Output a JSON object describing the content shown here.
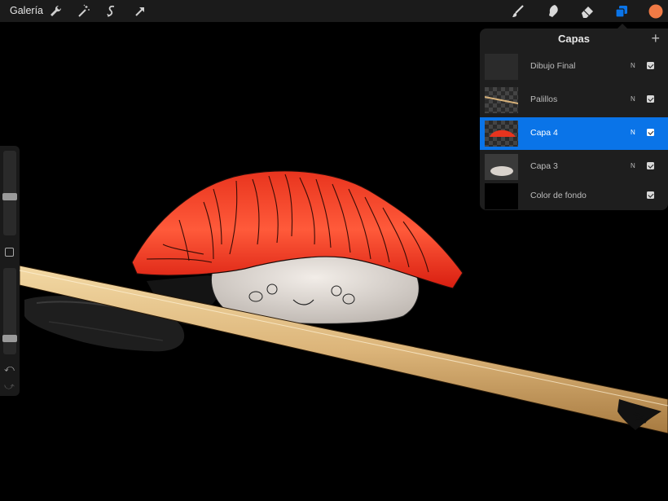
{
  "topbar": {
    "gallery_label": "Galería",
    "left_tools": [
      "wrench-icon",
      "magic-wand-icon",
      "selection-icon",
      "transform-arrow-icon"
    ],
    "right_tools": [
      "brush-icon",
      "smudge-icon",
      "eraser-icon",
      "layers-icon",
      "color-swatch"
    ],
    "active_color": "#f07a45",
    "accent_color": "#0a74e8"
  },
  "layers": {
    "title": "Capas",
    "add_icon": "plus-icon",
    "items": [
      {
        "name": "Dibujo Final",
        "mode": "N",
        "visible": true,
        "selected": false
      },
      {
        "name": "Palillos",
        "mode": "N",
        "visible": true,
        "selected": false
      },
      {
        "name": "Capa 4",
        "mode": "N",
        "visible": true,
        "selected": true
      },
      {
        "name": "Capa 3",
        "mode": "N",
        "visible": true,
        "selected": false
      },
      {
        "name": "Color de fondo",
        "mode": "",
        "visible": true,
        "selected": false
      }
    ]
  },
  "sidebar": {
    "brush_size_level": 0.45,
    "opacity_level": 0.15
  }
}
